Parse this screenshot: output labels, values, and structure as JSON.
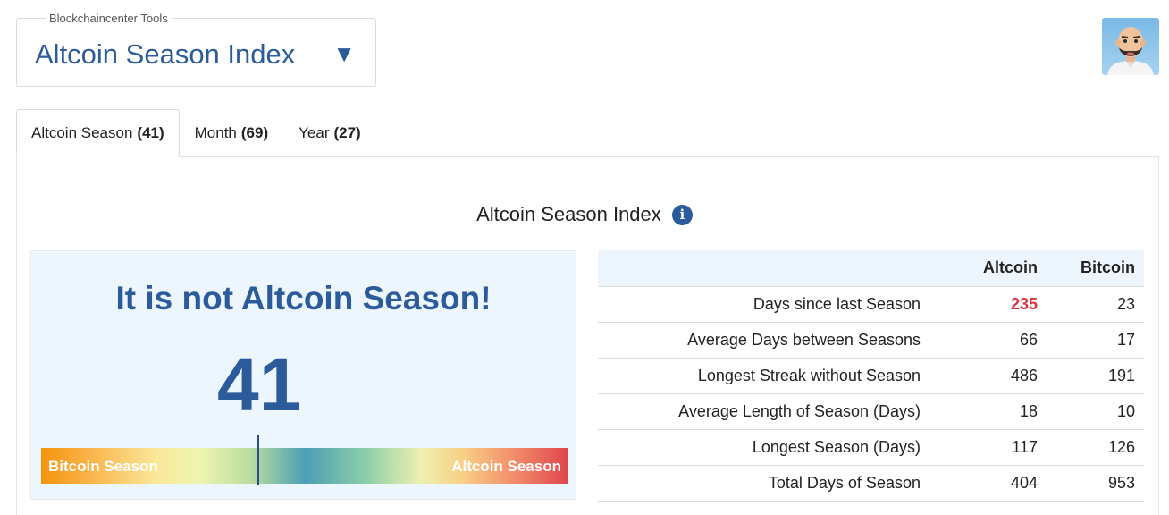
{
  "tool_selector": {
    "legend": "Blockchaincenter Tools",
    "selected": "Altcoin Season Index",
    "arrow": "▼"
  },
  "avatar": {
    "icon": "cartoon-avatar-icon"
  },
  "tabs": [
    {
      "label": "Altcoin Season",
      "count": "(41)",
      "active": true
    },
    {
      "label": "Month",
      "count": "(69)",
      "active": false
    },
    {
      "label": "Year",
      "count": "(27)",
      "active": false
    }
  ],
  "section": {
    "title": "Altcoin Season Index",
    "info_icon": "i"
  },
  "gauge": {
    "headline": "It is not Altcoin Season!",
    "value": "41",
    "value_percent": 41,
    "left_label": "Bitcoin Season",
    "right_label": "Altcoin Season"
  },
  "stats": {
    "headers": [
      "",
      "Altcoin",
      "Bitcoin"
    ],
    "rows": [
      {
        "label": "Days since last Season",
        "altcoin": "235",
        "bitcoin": "23"
      },
      {
        "label": "Average Days between Seasons",
        "altcoin": "66",
        "bitcoin": "17"
      },
      {
        "label": "Longest Streak without Season",
        "altcoin": "486",
        "bitcoin": "191"
      },
      {
        "label": "Average Length of Season (Days)",
        "altcoin": "18",
        "bitcoin": "10"
      },
      {
        "label": "Longest Season (Days)",
        "altcoin": "117",
        "bitcoin": "126"
      },
      {
        "label": "Total Days of Season",
        "altcoin": "404",
        "bitcoin": "953"
      }
    ]
  },
  "colors": {
    "brand_blue": "#2c5b9c",
    "highlight_red": "#d9333f",
    "panel_bg": "#eef6fd"
  }
}
